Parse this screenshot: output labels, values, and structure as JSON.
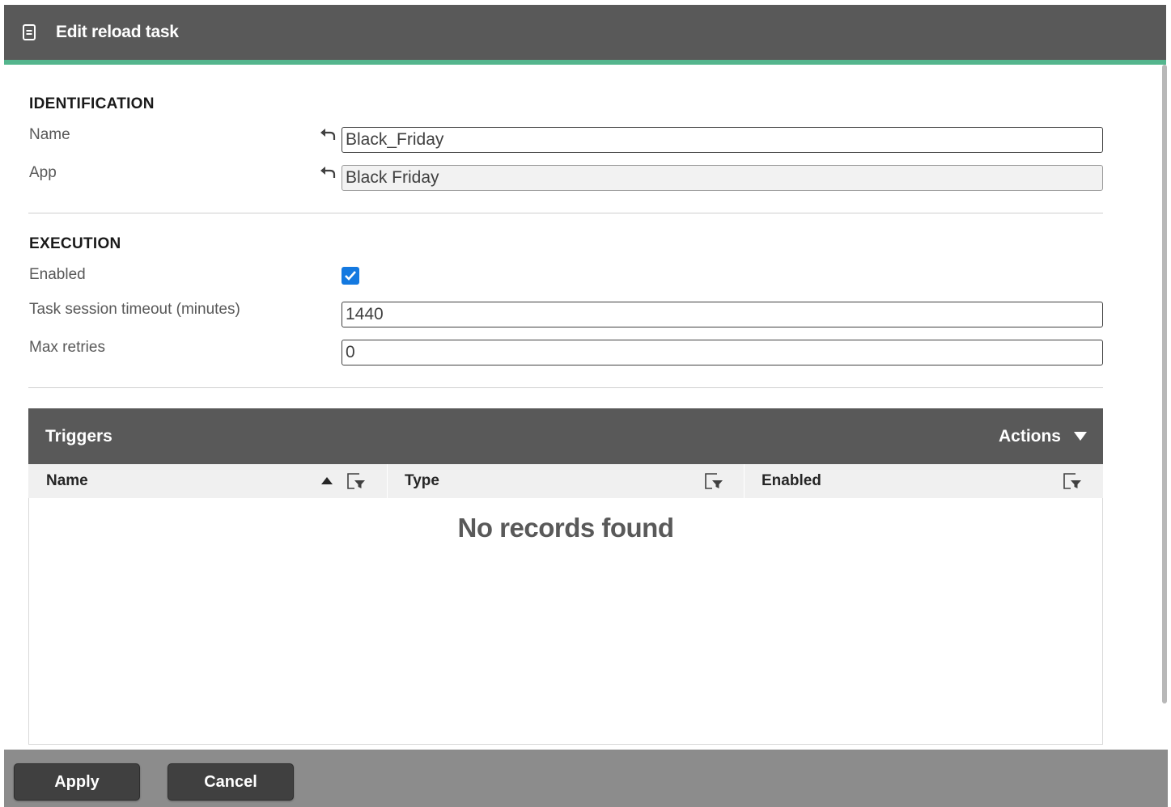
{
  "dialog": {
    "title": "Edit reload task",
    "title_icon": "document-icon",
    "accent_color": "#54b58d",
    "header_color": "#595959"
  },
  "identification": {
    "heading": "IDENTIFICATION",
    "name_label": "Name",
    "name_value": "Black_Friday",
    "app_label": "App",
    "app_value": "Black Friday",
    "revert_icon": "undo-arrow-icon"
  },
  "execution": {
    "heading": "EXECUTION",
    "enabled_label": "Enabled",
    "enabled": true,
    "timeout_label": "Task session timeout (minutes)",
    "timeout_value": "1440",
    "retries_label": "Max retries",
    "retries_value": "0",
    "checkbox_color": "#1479e0"
  },
  "triggers": {
    "title": "Triggers",
    "actions_label": "Actions",
    "columns": [
      {
        "label": "Name",
        "sorted": "ascending"
      },
      {
        "label": "Type"
      },
      {
        "label": "Enabled"
      }
    ],
    "empty_message": "No records found"
  },
  "footer": {
    "apply_label": "Apply",
    "cancel_label": "Cancel"
  }
}
